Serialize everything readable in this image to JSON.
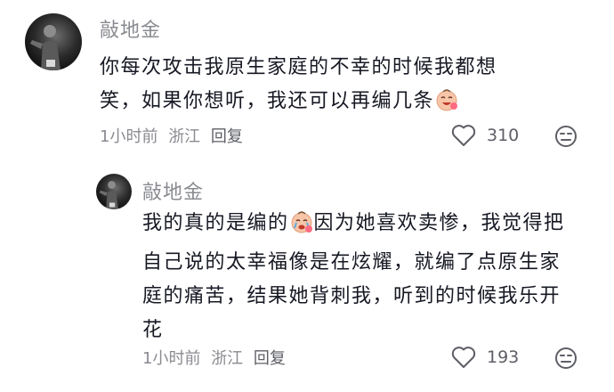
{
  "comments": [
    {
      "username": "敲地金",
      "text_before_emoji": "你每次攻击我原生家庭的不幸的时候我都想笑，如果你想听，我还可以再编几条",
      "text_after_emoji": "",
      "emoji": "laughing-baby-emoji",
      "time": "1小时前",
      "location": "浙江",
      "reply_label": "回复",
      "likes": "310"
    },
    {
      "username": "敲地金",
      "text_before_emoji": "我的真的是编的",
      "text_after_emoji": "因为她喜欢卖惨，我觉得把自己说的太幸福像是在炫耀，就编了点原生家庭的痛苦，结果她背刺我，听到的时候我乐开花",
      "emoji": "crying-baby-emoji",
      "time": "1小时前",
      "location": "浙江",
      "reply_label": "回复",
      "likes": "193"
    }
  ],
  "icons": {
    "like": "heart-outline-icon",
    "dislike": "dislike-face-icon"
  },
  "colors": {
    "meta": "#8a8b91",
    "text": "#161823",
    "emoji_face": "#f7c5a8"
  }
}
